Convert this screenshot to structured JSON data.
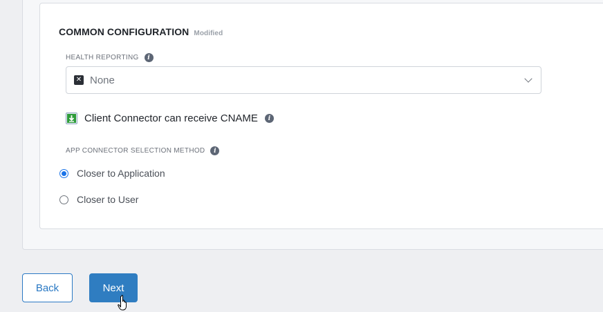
{
  "section": {
    "title": "COMMON CONFIGURATION",
    "status": "Modified"
  },
  "health_reporting": {
    "label": "HEALTH REPORTING",
    "value": "None",
    "value_icon": "x-square-icon"
  },
  "cname": {
    "label": "Client Connector can receive CNAME",
    "icon": "download-checkbox-icon"
  },
  "selection_method": {
    "label": "APP CONNECTOR SELECTION METHOD",
    "options": [
      {
        "label": "Closer to Application",
        "selected": true
      },
      {
        "label": "Closer to User",
        "selected": false
      }
    ]
  },
  "buttons": {
    "back": "Back",
    "next": "Next"
  },
  "colors": {
    "primary": "#2f7dc1",
    "radio_selected": "#1a73e8"
  }
}
